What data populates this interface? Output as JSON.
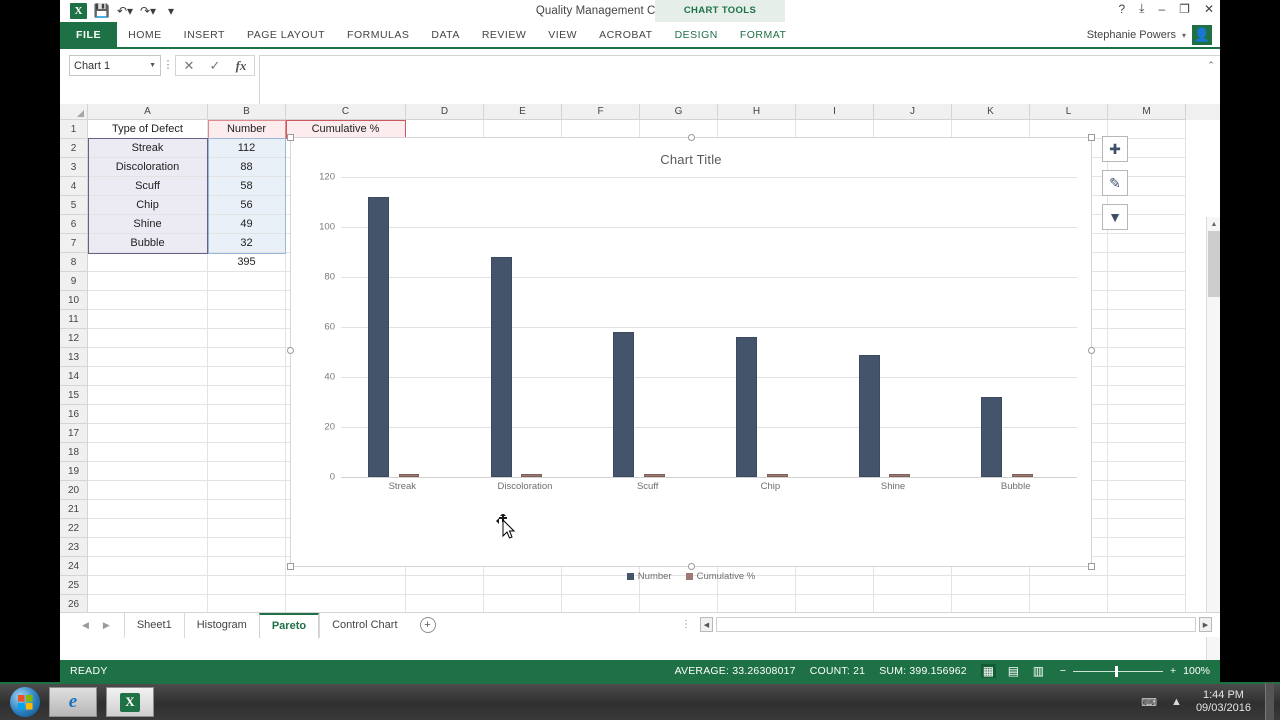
{
  "window": {
    "title": "Quality Management Charts.xlsx - Excel",
    "quick_access": [
      "excel-logo",
      "save-icon",
      "undo-icon",
      "redo-icon",
      "customize-icon"
    ],
    "controls": [
      "help-icon",
      "ribbon-display-icon",
      "minimize-icon",
      "restore-icon",
      "close-icon"
    ],
    "control_glyphs": {
      "help": "?",
      "ribbon": "⤓",
      "minimize": "–",
      "restore": "❐",
      "close": "✕"
    }
  },
  "contextual": {
    "banner": "CHART TOOLS",
    "tabs": [
      "DESIGN",
      "FORMAT"
    ]
  },
  "ribbon": {
    "file_tab": "FILE",
    "tabs": [
      "HOME",
      "INSERT",
      "PAGE LAYOUT",
      "FORMULAS",
      "DATA",
      "REVIEW",
      "VIEW",
      "ACROBAT"
    ]
  },
  "account": {
    "name": "Stephanie Powers",
    "caret": "▾"
  },
  "formula_bar": {
    "name_box_value": "Chart 1",
    "cancel_glyph": "✕",
    "enter_glyph": "✓",
    "function_glyph": "fx",
    "formula_value": "",
    "expand_glyph": "⌃"
  },
  "grid": {
    "columns": [
      "A",
      "B",
      "C",
      "D",
      "E",
      "F",
      "G",
      "H",
      "I",
      "J",
      "K",
      "L",
      "M"
    ],
    "rows": [
      1,
      2,
      3,
      4,
      5,
      6,
      7,
      8,
      9,
      10,
      11,
      12,
      13,
      14,
      15,
      16,
      17,
      18,
      19,
      20,
      21,
      22,
      23,
      24,
      25,
      26
    ],
    "data": [
      {
        "row": 1,
        "A": "Type of Defect",
        "B": "Number",
        "C": "Cumulative %"
      },
      {
        "row": 2,
        "A": "Streak",
        "B": "112",
        "C": ""
      },
      {
        "row": 3,
        "A": "Discoloration",
        "B": "88",
        "C": ""
      },
      {
        "row": 4,
        "A": "Scuff",
        "B": "58",
        "C": ""
      },
      {
        "row": 5,
        "A": "Chip",
        "B": "56",
        "C": ""
      },
      {
        "row": 6,
        "A": "Shine",
        "B": "49",
        "C": ""
      },
      {
        "row": 7,
        "A": "Bubble",
        "B": "32",
        "C": ""
      },
      {
        "row": 8,
        "A": "",
        "B": "395",
        "C": ""
      }
    ]
  },
  "chart_data": {
    "type": "bar",
    "title": "Chart Title",
    "categories": [
      "Streak",
      "Discoloration",
      "Scuff",
      "Chip",
      "Shine",
      "Bubble"
    ],
    "series": [
      {
        "name": "Number",
        "values": [
          112,
          88,
          58,
          56,
          49,
          32
        ],
        "color": "#44546a"
      },
      {
        "name": "Cumulative %",
        "values": [
          0.28,
          0.51,
          0.65,
          0.8,
          0.92,
          1.0
        ],
        "color": "#9e7b72"
      }
    ],
    "ylim": [
      0,
      120
    ],
    "yticks": [
      0,
      20,
      40,
      60,
      80,
      100,
      120
    ],
    "xlabel": "",
    "ylabel": "",
    "grid": true,
    "legend_position": "bottom"
  },
  "chart_buttons": [
    {
      "name": "chart-elements",
      "glyph": "✚"
    },
    {
      "name": "chart-styles",
      "glyph": "✎"
    },
    {
      "name": "chart-filters",
      "glyph": "▼"
    }
  ],
  "sheet_tabs": {
    "prev_glyph": "◀",
    "next_glyph": "▶",
    "tabs": [
      "Sheet1",
      "Histogram",
      "Pareto",
      "Control Chart"
    ],
    "active": "Pareto",
    "add_glyph": "+",
    "dots_glyph": "⋮",
    "scroll_left_glyph": "◀",
    "scroll_right_glyph": "▶"
  },
  "status_bar": {
    "state": "READY",
    "average": "AVERAGE: 33.26308017",
    "count": "COUNT: 21",
    "sum": "SUM: 399.156962",
    "views": [
      "normal-view",
      "page-layout-view",
      "page-break-view"
    ],
    "view_glyphs": [
      "▦",
      "▤",
      "▥"
    ],
    "zoom_minus": "−",
    "zoom_plus": "+",
    "zoom_level": "100%"
  },
  "taskbar": {
    "start": "start-button",
    "items": [
      "internet-explorer",
      "excel"
    ],
    "ie_glyph": "e",
    "excel_glyph": "X",
    "tray": [
      "keyboard-icon",
      "show-hidden-icons"
    ],
    "keyboard_glyph": "⌨",
    "chevron_glyph": "▲",
    "time": "1:44 PM",
    "date": "09/03/2016"
  },
  "scroll": {
    "up_glyph": "▲",
    "down_glyph": "▼"
  }
}
